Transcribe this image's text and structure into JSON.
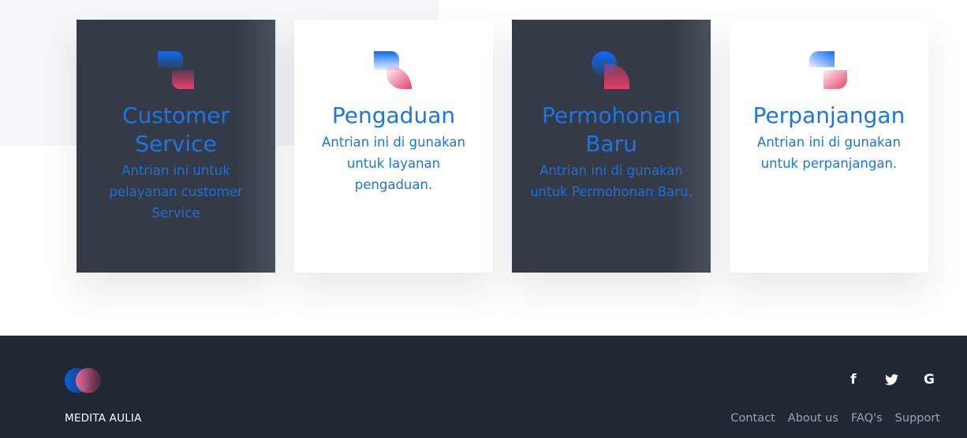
{
  "colors": {
    "accent_blue": "#1a76e6",
    "dark_card": "#343a46",
    "footer_bg": "#1f2833",
    "gradient_blue": "#0a6cff",
    "gradient_pink": "#e63f6b"
  },
  "cards": [
    {
      "title": "Customer Service",
      "description": "Antrian ini untuk pelayanan customer Service",
      "icon": "customer-service-logo-icon",
      "theme": "dark"
    },
    {
      "title": "Pengaduan",
      "description": "Antrian ini di gunakan untuk layanan pengaduan.",
      "icon": "complaint-logo-icon",
      "theme": "light"
    },
    {
      "title": "Permohonan Baru",
      "description": "Antrian ini di gunakan untuk Permohonan Baru.",
      "icon": "new-application-logo-icon",
      "theme": "dark"
    },
    {
      "title": "Perpanjangan",
      "description": "Antrian ini di gunakan untuk perpanjangan.",
      "icon": "renewal-logo-icon",
      "theme": "light"
    }
  ],
  "footer": {
    "brand": "MEDITA AULIA",
    "social": [
      {
        "name": "facebook-icon",
        "glyph": "f"
      },
      {
        "name": "twitter-icon",
        "glyph": "t"
      },
      {
        "name": "google-icon",
        "glyph": "G"
      }
    ],
    "links": [
      "Contact",
      "About us",
      "FAQ's",
      "Support"
    ]
  }
}
